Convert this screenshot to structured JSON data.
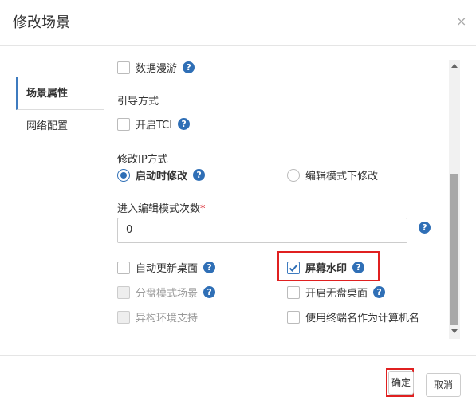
{
  "dialog": {
    "title": "修改场景",
    "close": "×"
  },
  "tabs": [
    {
      "label": "场景属性"
    },
    {
      "label": "网络配置"
    }
  ],
  "form": {
    "data_roaming": "数据漫游",
    "boot_mode_label": "引导方式",
    "tci_label": "开启TCI",
    "ip_mode_label": "修改IP方式",
    "ip_mode_options": [
      "启动时修改",
      "编辑模式下修改"
    ],
    "ip_mode_selected": "启动时修改",
    "edit_count_label": "进入编辑模式次数",
    "edit_count_required": "*",
    "edit_count_value": "0",
    "auto_update_desktop": "自动更新桌面",
    "screen_watermark": "屏幕水印",
    "screen_watermark_checked": true,
    "split_disk_mode": "分盘模式场景",
    "diskless_desktop": "开启无盘桌面",
    "heterogeneous_env": "异构环境支持",
    "use_terminal_name": "使用终端名作为计算机名",
    "help_glyph": "?"
  },
  "footer": {
    "ok": "确定",
    "cancel": "取消"
  },
  "colors": {
    "accent": "#2f6fb6",
    "highlight": "#e02020"
  }
}
